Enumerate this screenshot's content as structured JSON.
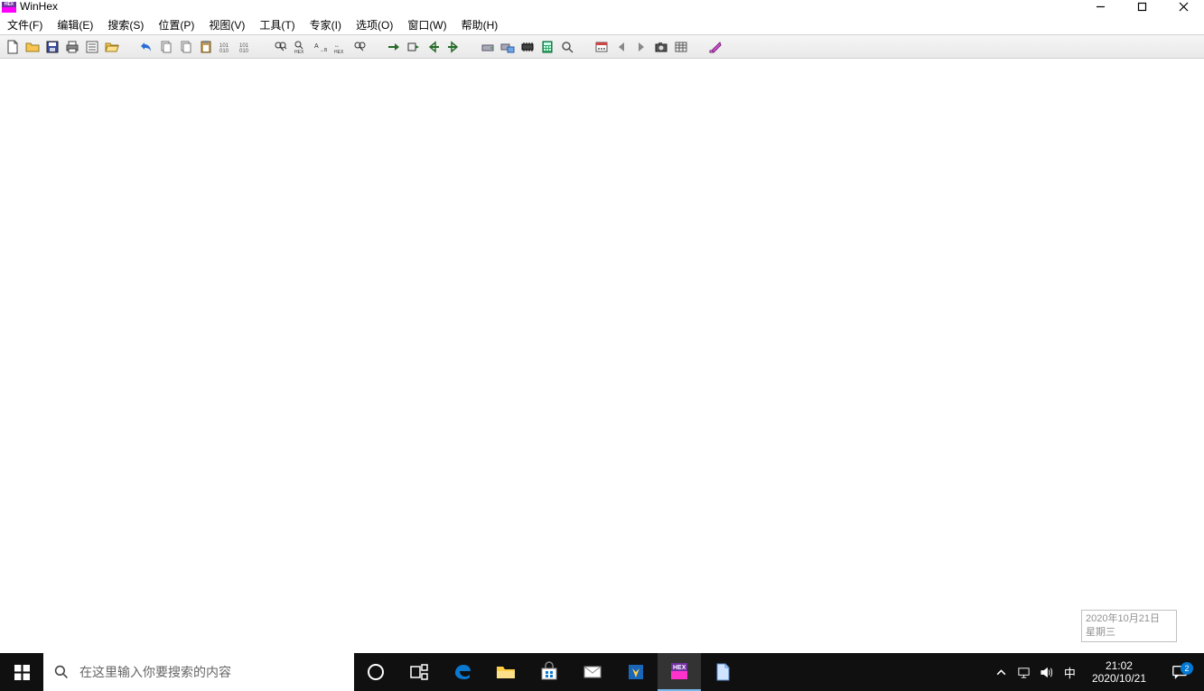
{
  "app": {
    "title": "WinHex"
  },
  "menu": {
    "items": [
      "文件(F)",
      "编辑(E)",
      "搜索(S)",
      "位置(P)",
      "视图(V)",
      "工具(T)",
      "专家(I)",
      "选项(O)",
      "窗口(W)",
      "帮助(H)"
    ]
  },
  "taskbar": {
    "search_placeholder": "在这里输入你要搜索的内容",
    "ime": "中",
    "time": "21:02",
    "date": "2020/10/21",
    "notif_count": "2"
  },
  "tooltip": {
    "line1": "2020年10月21日",
    "line2": "星期三"
  }
}
